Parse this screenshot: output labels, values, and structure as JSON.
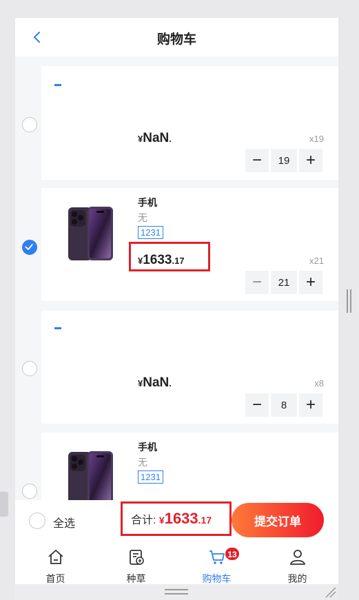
{
  "header": {
    "title": "购物车"
  },
  "cart_items": [
    {
      "name": "",
      "spec": "",
      "tag": "",
      "price_currency": "¥",
      "price_int": "NaN",
      "price_dec": ".",
      "qty_label": "x19",
      "qty": "19",
      "checked": false,
      "has_image": false
    },
    {
      "name": "手机",
      "spec": "无",
      "tag": "1231",
      "price_currency": "¥",
      "price_int": "1633",
      "price_dec": ".17",
      "qty_label": "x21",
      "qty": "21",
      "checked": true,
      "has_image": true
    },
    {
      "name": "",
      "spec": "",
      "tag": "",
      "price_currency": "¥",
      "price_int": "NaN",
      "price_dec": ".",
      "qty_label": "x8",
      "qty": "8",
      "checked": false,
      "has_image": false
    },
    {
      "name": "手机",
      "spec": "无",
      "tag": "1231",
      "checked": false,
      "has_image": true
    }
  ],
  "stepper": {
    "minus": "−",
    "plus": "+"
  },
  "footer": {
    "select_all": "全选",
    "total_label": "合计:",
    "total_currency": "¥",
    "total_int": "1633",
    "total_dec": ".17",
    "submit": "提交订单"
  },
  "tabbar": {
    "items": [
      {
        "label": "首页",
        "icon": "home-icon"
      },
      {
        "label": "种草",
        "icon": "notes-icon"
      },
      {
        "label": "购物车",
        "icon": "cart-icon",
        "badge": "13",
        "active": true
      },
      {
        "label": "我的",
        "icon": "user-icon"
      }
    ]
  },
  "colors": {
    "accent": "#2f7ff0",
    "price_red": "#e0212b",
    "highlight_box": "#e0212b"
  }
}
